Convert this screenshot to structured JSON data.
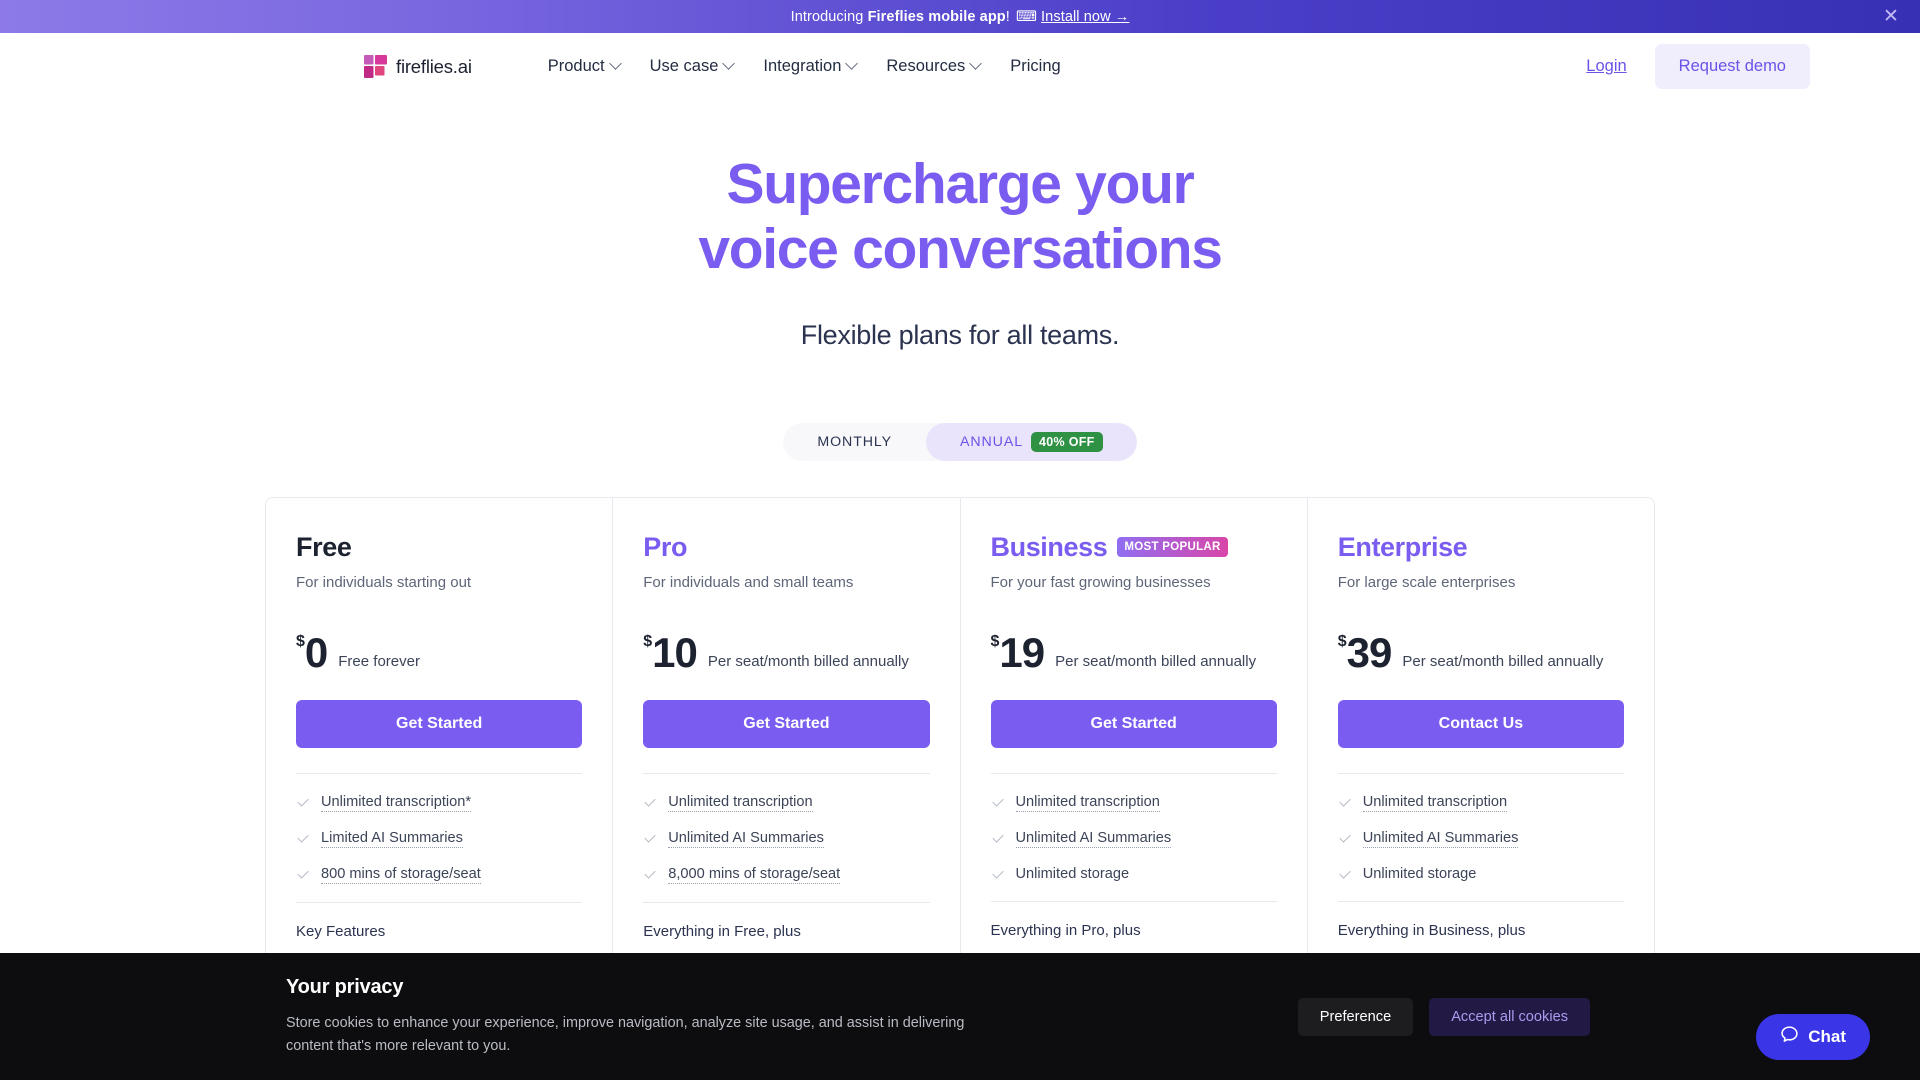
{
  "banner": {
    "prefix": "Introducing ",
    "bold": "Fireflies mobile app",
    "suffix": "! ",
    "emoji": "⌨",
    "link": "Install now →",
    "close_icon": "✕"
  },
  "nav": {
    "logo_text": "fireflies.ai",
    "links": [
      {
        "label": "Product",
        "has_chevron": true
      },
      {
        "label": "Use case",
        "has_chevron": true
      },
      {
        "label": "Integration",
        "has_chevron": true
      },
      {
        "label": "Resources",
        "has_chevron": true
      },
      {
        "label": "Pricing",
        "has_chevron": false
      }
    ],
    "login_label": "Login",
    "demo_label": "Request demo"
  },
  "hero": {
    "title_line1": "Supercharge your",
    "title_line2": "voice conversations",
    "subtitle": "Flexible plans for all teams.",
    "accent_color": "#7b5cf0"
  },
  "billing_toggle": {
    "monthly_label": "MONTHLY",
    "annual_label": "ANNUAL",
    "discount_badge": "40% OFF",
    "active": "ANNUAL"
  },
  "plans": [
    {
      "name": "Free",
      "badge": null,
      "description": "For individuals starting out",
      "currency": "$",
      "price": "0",
      "price_note": "Free forever",
      "cta": "Get Started",
      "features": [
        {
          "text": "Unlimited transcription*",
          "dotted": true
        },
        {
          "text": "Limited AI Summaries",
          "dotted": true
        },
        {
          "text": "800 mins of storage/seat",
          "dotted": true
        }
      ],
      "everything": "Key Features"
    },
    {
      "name": "Pro",
      "badge": null,
      "description": "For individuals and small teams",
      "currency": "$",
      "price": "10",
      "price_note": "Per seat/month billed annually",
      "cta": "Get Started",
      "features": [
        {
          "text": "Unlimited transcription",
          "dotted": true
        },
        {
          "text": "Unlimited AI Summaries",
          "dotted": true
        },
        {
          "text": "8,000 mins of storage/seat",
          "dotted": true
        }
      ],
      "everything": "Everything in Free, plus"
    },
    {
      "name": "Business",
      "badge": "MOST POPULAR",
      "description": "For your fast growing businesses",
      "currency": "$",
      "price": "19",
      "price_note": "Per seat/month billed annually",
      "cta": "Get Started",
      "features": [
        {
          "text": "Unlimited transcription",
          "dotted": true
        },
        {
          "text": "Unlimited AI Summaries",
          "dotted": true
        },
        {
          "text": "Unlimited storage",
          "dotted": false
        }
      ],
      "everything": "Everything in Pro, plus"
    },
    {
      "name": "Enterprise",
      "badge": null,
      "description": "For large scale enterprises",
      "currency": "$",
      "price": "39",
      "price_note": "Per seat/month billed annually",
      "cta": "Contact Us",
      "features": [
        {
          "text": "Unlimited transcription",
          "dotted": true
        },
        {
          "text": "Unlimited AI Summaries",
          "dotted": true
        },
        {
          "text": "Unlimited storage",
          "dotted": false
        }
      ],
      "everything": "Everything in Business, plus"
    }
  ],
  "cookie": {
    "title": "Your privacy",
    "body": "Store cookies to enhance your experience, improve navigation, analyze site usage, and assist in delivering content that's more relevant to you.",
    "preference_label": "Preference",
    "accept_label": "Accept all cookies"
  },
  "chat": {
    "label": "Chat"
  },
  "colors": {
    "brand_purple": "#7b5cf0",
    "link_purple": "#6c52e8",
    "badge_green": "#2f9143",
    "logo_pink": "#d6399a",
    "chat_blue": "#3b35e8"
  }
}
